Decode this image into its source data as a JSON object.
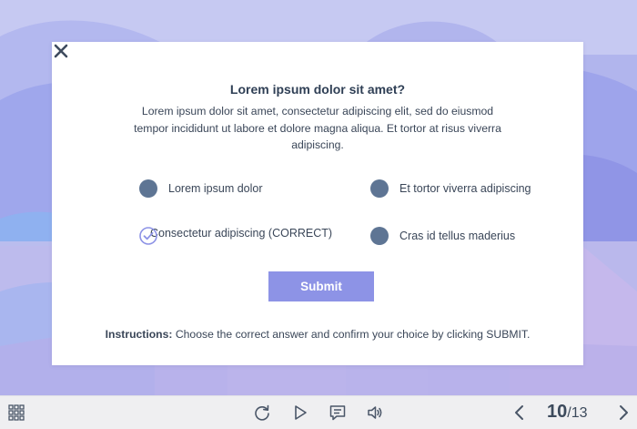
{
  "modal": {
    "title": "Lorem ipsum dolor sit amet?",
    "description": "Lorem ipsum dolor sit amet, consectetur adipiscing elit, sed do eiusmod tempor incididunt ut labore et dolore magna aliqua. Et tortor at risus viverra adipiscing.",
    "options": [
      {
        "label": "Lorem ipsum dolor",
        "state": "filled"
      },
      {
        "label": "Et tortor viverra adipiscing",
        "state": "filled"
      },
      {
        "label": "Consectetur adipiscing (CORRECT)",
        "state": "checked"
      },
      {
        "label": "Cras id tellus maderius",
        "state": "filled"
      }
    ],
    "submit_label": "Submit",
    "instructions_label": "Instructions:",
    "instructions_text": " Choose the correct answer and confirm your choice by clicking SUBMIT.",
    "close_icon": "close-icon"
  },
  "toolbar": {
    "menu_icon": "grid-menu-icon",
    "replay_icon": "replay-icon",
    "play_icon": "play-icon",
    "notes_icon": "notes-icon",
    "audio_icon": "audio-icon",
    "prev_icon": "chevron-left-icon",
    "next_icon": "chevron-right-icon",
    "current_page": "10",
    "total_pages": "/13"
  },
  "colors": {
    "accent": "#8d93e6",
    "option_dot": "#5e7594",
    "text": "#3a4658",
    "check": "#8d93e6"
  }
}
